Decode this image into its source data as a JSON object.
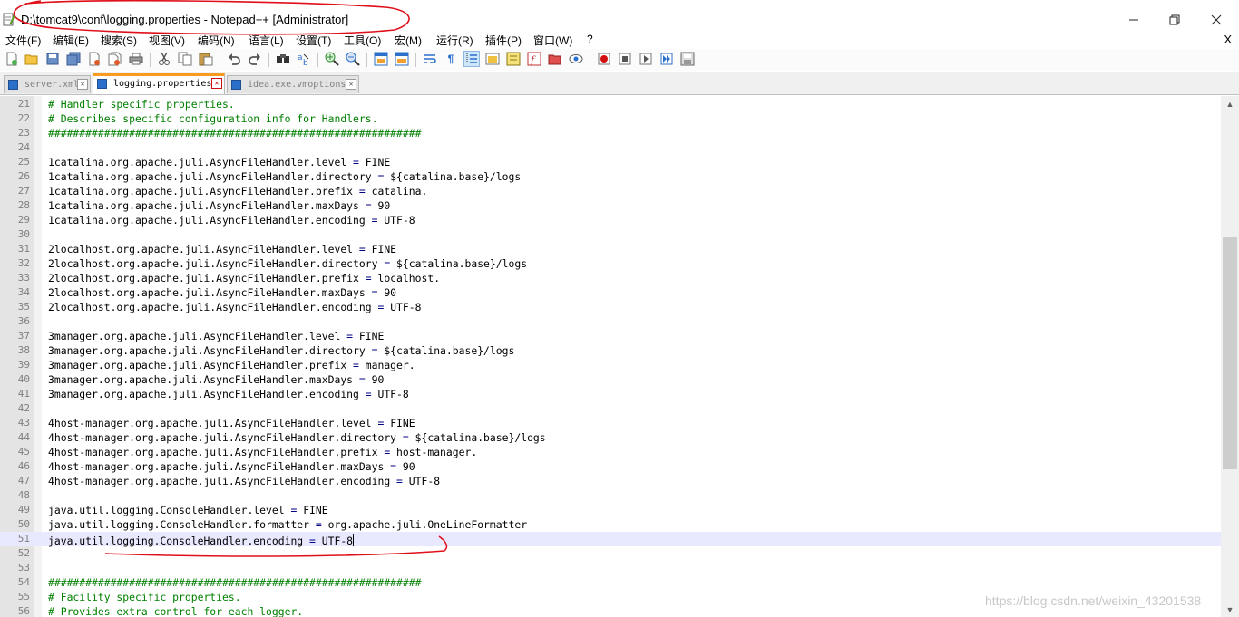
{
  "window": {
    "title": "D:\\tomcat9\\conf\\logging.properties - Notepad++ [Administrator]",
    "controls": [
      "minimize-icon",
      "restore-icon",
      "close-icon"
    ]
  },
  "menu": {
    "items": [
      "文件(F)",
      "编辑(E)",
      "搜索(S)",
      "视图(V)",
      "编码(N)",
      "语言(L)",
      "设置(T)",
      "工具(O)",
      "宏(M)",
      "运行(R)",
      "插件(P)",
      "窗口(W)",
      "?"
    ],
    "close_doc": "X"
  },
  "toolbar": {
    "icons": [
      "new-file-icon",
      "open-file-icon",
      "save-icon",
      "save-all-icon",
      "close-icon",
      "close-all-icon",
      "print-icon",
      "cut-icon",
      "copy-icon",
      "paste-icon",
      "undo-icon",
      "redo-icon",
      "find-icon",
      "replace-icon",
      "zoom-in-icon",
      "zoom-out-icon",
      "sync-vertical-icon",
      "sync-horizontal-icon",
      "word-wrap-icon",
      "show-all-chars-icon",
      "indent-guide-icon",
      "user-language-icon",
      "document-map-icon",
      "function-list-icon",
      "folder-workspace-icon",
      "monitoring-icon",
      "record-macro-icon",
      "stop-macro-icon",
      "play-macro-icon",
      "run-macro-multiple-icon",
      "save-macro-icon"
    ],
    "active_icon": "indent-guide-icon"
  },
  "tabs": [
    {
      "label": "server.xml",
      "active": false
    },
    {
      "label": "logging.properties",
      "active": true
    },
    {
      "label": "idea.exe.vmoptions",
      "active": false
    }
  ],
  "editor": {
    "current_line": 51,
    "lines": [
      {
        "n": "21",
        "text": "# Handler specific properties.",
        "comment": true
      },
      {
        "n": "22",
        "text": "# Describes specific configuration info for Handlers.",
        "comment": true
      },
      {
        "n": "23",
        "text": "############################################################",
        "comment": true
      },
      {
        "n": "24",
        "text": ""
      },
      {
        "n": "25",
        "key": "1catalina.org.apache.juli.AsyncFileHandler.level",
        "value": "FINE"
      },
      {
        "n": "26",
        "key": "1catalina.org.apache.juli.AsyncFileHandler.directory",
        "value": "${catalina.base}/logs"
      },
      {
        "n": "27",
        "key": "1catalina.org.apache.juli.AsyncFileHandler.prefix",
        "value": "catalina."
      },
      {
        "n": "28",
        "key": "1catalina.org.apache.juli.AsyncFileHandler.maxDays",
        "value": "90"
      },
      {
        "n": "29",
        "key": "1catalina.org.apache.juli.AsyncFileHandler.encoding",
        "value": "UTF-8"
      },
      {
        "n": "30",
        "text": ""
      },
      {
        "n": "31",
        "key": "2localhost.org.apache.juli.AsyncFileHandler.level",
        "value": "FINE"
      },
      {
        "n": "32",
        "key": "2localhost.org.apache.juli.AsyncFileHandler.directory",
        "value": "${catalina.base}/logs"
      },
      {
        "n": "33",
        "key": "2localhost.org.apache.juli.AsyncFileHandler.prefix",
        "value": "localhost."
      },
      {
        "n": "34",
        "key": "2localhost.org.apache.juli.AsyncFileHandler.maxDays",
        "value": "90"
      },
      {
        "n": "35",
        "key": "2localhost.org.apache.juli.AsyncFileHandler.encoding",
        "value": "UTF-8"
      },
      {
        "n": "36",
        "text": ""
      },
      {
        "n": "37",
        "key": "3manager.org.apache.juli.AsyncFileHandler.level",
        "value": "FINE"
      },
      {
        "n": "38",
        "key": "3manager.org.apache.juli.AsyncFileHandler.directory",
        "value": "${catalina.base}/logs"
      },
      {
        "n": "39",
        "key": "3manager.org.apache.juli.AsyncFileHandler.prefix",
        "value": "manager."
      },
      {
        "n": "40",
        "key": "3manager.org.apache.juli.AsyncFileHandler.maxDays",
        "value": "90"
      },
      {
        "n": "41",
        "key": "3manager.org.apache.juli.AsyncFileHandler.encoding",
        "value": "UTF-8"
      },
      {
        "n": "42",
        "text": ""
      },
      {
        "n": "43",
        "key": "4host-manager.org.apache.juli.AsyncFileHandler.level",
        "value": "FINE"
      },
      {
        "n": "44",
        "key": "4host-manager.org.apache.juli.AsyncFileHandler.directory",
        "value": "${catalina.base}/logs"
      },
      {
        "n": "45",
        "key": "4host-manager.org.apache.juli.AsyncFileHandler.prefix",
        "value": "host-manager."
      },
      {
        "n": "46",
        "key": "4host-manager.org.apache.juli.AsyncFileHandler.maxDays",
        "value": "90"
      },
      {
        "n": "47",
        "key": "4host-manager.org.apache.juli.AsyncFileHandler.encoding",
        "value": "UTF-8"
      },
      {
        "n": "48",
        "text": ""
      },
      {
        "n": "49",
        "key": "java.util.logging.ConsoleHandler.level",
        "value": "FINE"
      },
      {
        "n": "50",
        "key": "java.util.logging.ConsoleHandler.formatter",
        "value": "org.apache.juli.OneLineFormatter"
      },
      {
        "n": "51",
        "key": "java.util.logging.ConsoleHandler.encoding",
        "value": "UTF-8"
      },
      {
        "n": "52",
        "text": ""
      },
      {
        "n": "53",
        "text": ""
      },
      {
        "n": "54",
        "text": "############################################################",
        "comment": true
      },
      {
        "n": "55",
        "text": "# Facility specific properties.",
        "comment": true
      },
      {
        "n": "56",
        "text": "# Provides extra control for each logger.",
        "comment": true
      }
    ]
  },
  "watermark": "https://blog.csdn.net/weixin_43201538",
  "colors": {
    "comment": "#008000",
    "operator": "#000080",
    "current_line": "#e8e8ff",
    "annotation": "#e0101a",
    "active_tab_accent": "#fa9a1e"
  }
}
